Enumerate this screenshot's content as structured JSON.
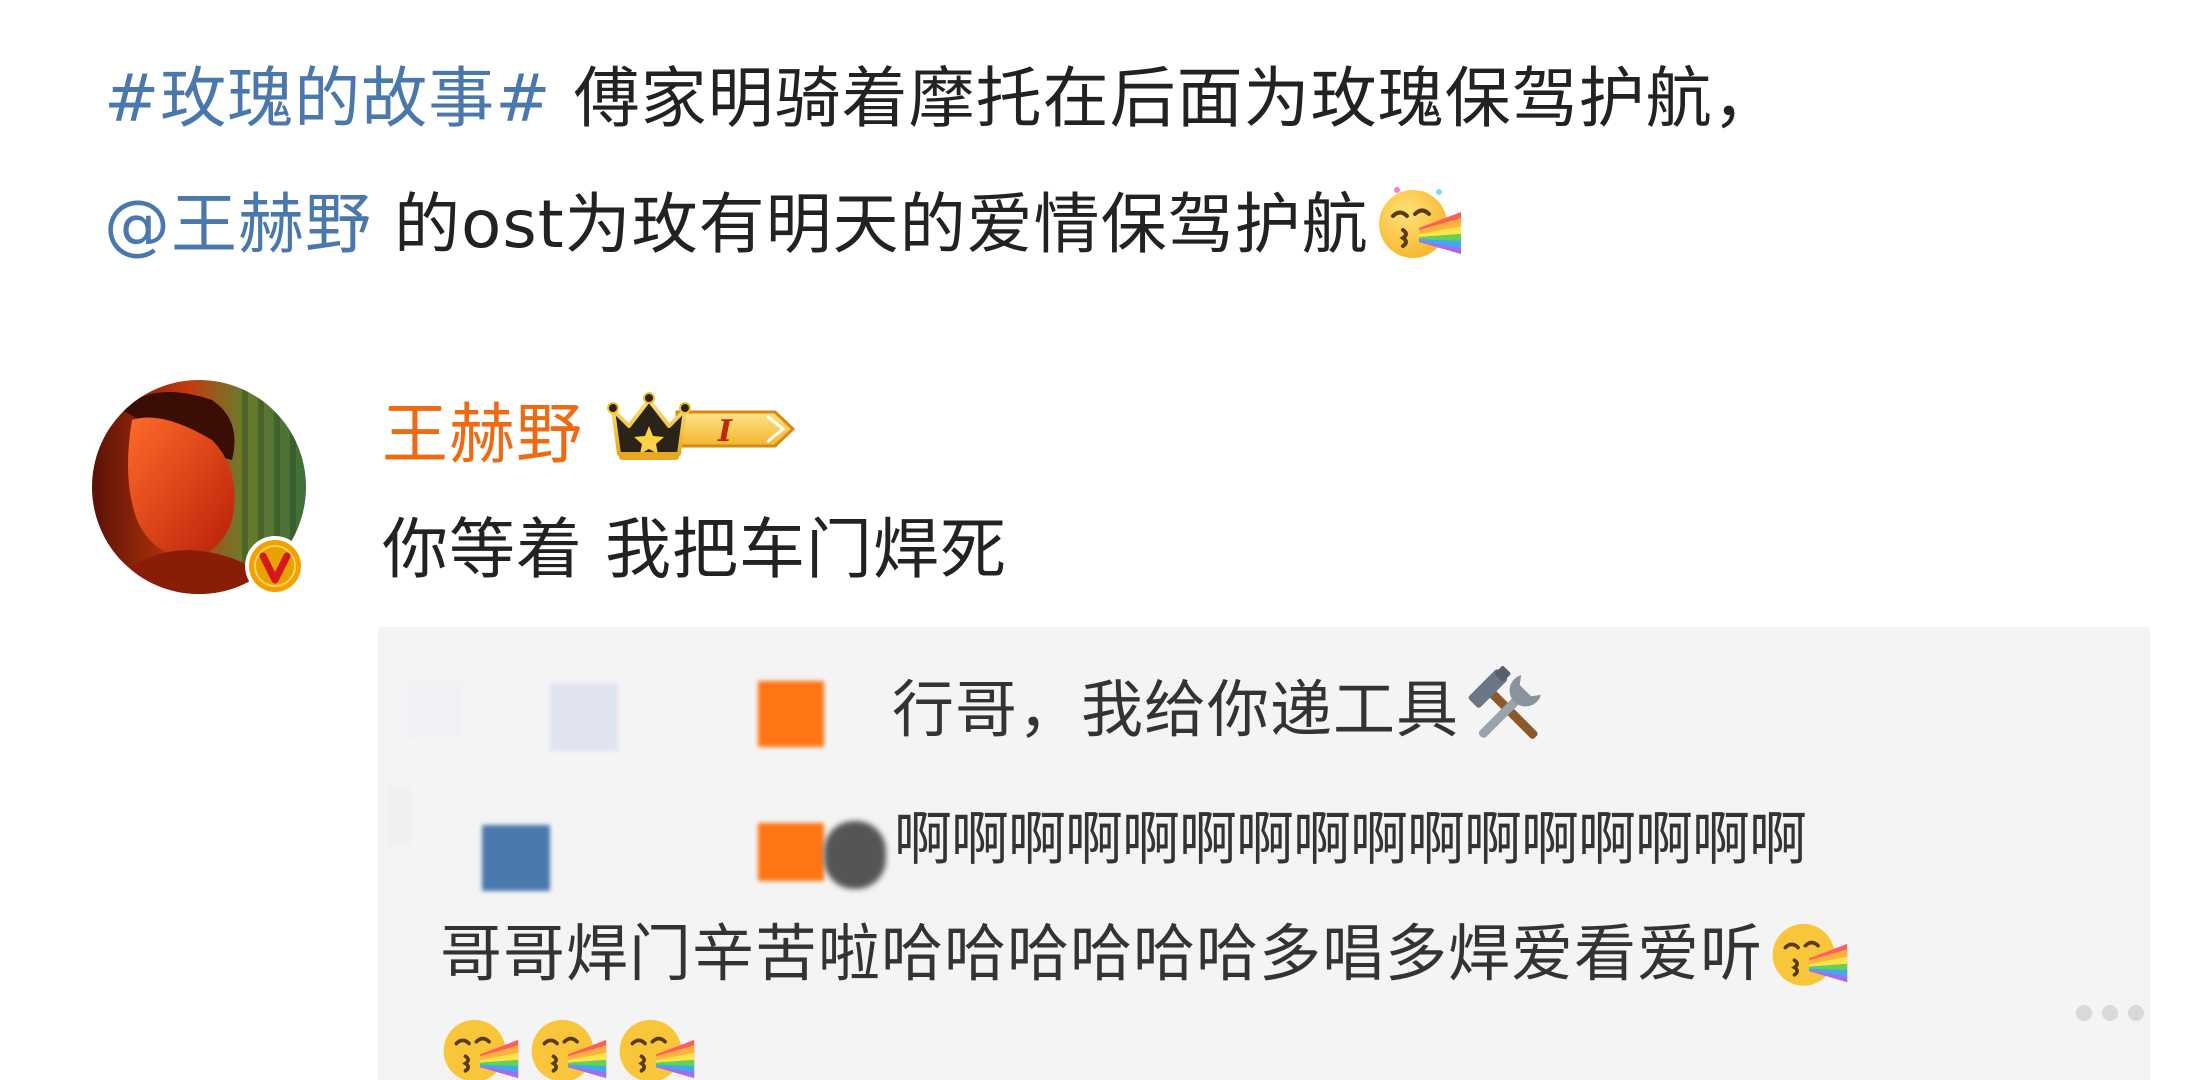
{
  "post": {
    "hashtag": "#玫瑰的故事#",
    "line1_text": " 傅家明骑着摩托在后面为玫瑰保驾护航，",
    "mention": "@王赫野",
    "line2_text": " 的ost为玫有明天的爱情保驾护航",
    "emoji_icon": "rainbow-kiss-emoji"
  },
  "comment": {
    "author": "王赫野",
    "level_badge": "I",
    "verified_icon": "v-badge-icon",
    "text": "你等着 我把车门焊死"
  },
  "replies": [
    {
      "text": "行哥，我给你递工具",
      "icon": "hammer-and-wrench-icon"
    },
    {
      "line1": "啊啊啊啊啊啊啊啊啊啊啊啊啊啊啊啊",
      "line2": "哥哥焊门辛苦啦哈哈哈哈哈哈多唱多焊爱看爱听",
      "emoji_icon": "rainbow-kiss-emoji"
    }
  ],
  "colors": {
    "link": "#4a78ad",
    "author": "#f06a13",
    "text": "#222222",
    "reply_bg": "#f4f4f4",
    "verify_badge": "#f3a000"
  }
}
